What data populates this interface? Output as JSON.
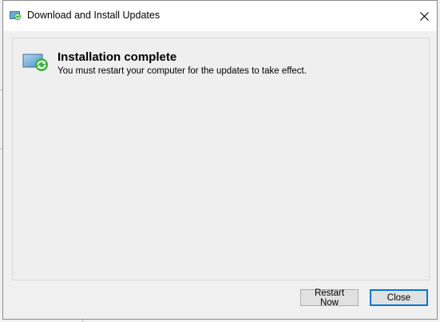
{
  "window": {
    "title": "Download and Install Updates",
    "close_glyph": "✕"
  },
  "message": {
    "heading": "Installation complete",
    "body": "You must restart your computer for the updates to take effect.",
    "icon": "windows-update-icon"
  },
  "buttons": {
    "restart_label": "Restart Now",
    "close_label": "Close"
  },
  "colors": {
    "accent": "#0078d7",
    "icon_green": "#3cb43c",
    "icon_blue": "#4a90c8"
  }
}
